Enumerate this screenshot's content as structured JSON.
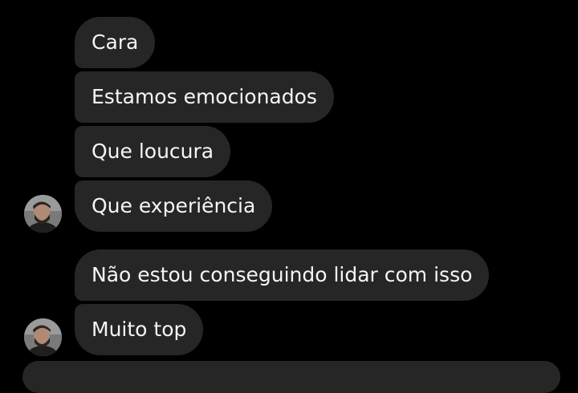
{
  "conversation": {
    "group1": [
      "Cara",
      "Estamos emocionados",
      "Que loucura",
      "Que experiência"
    ],
    "group2": [
      "Não estou conseguindo lidar com isso",
      "Muito top"
    ]
  },
  "colors": {
    "background": "#000000",
    "bubble": "#262626",
    "text": "#f5f5f5"
  }
}
